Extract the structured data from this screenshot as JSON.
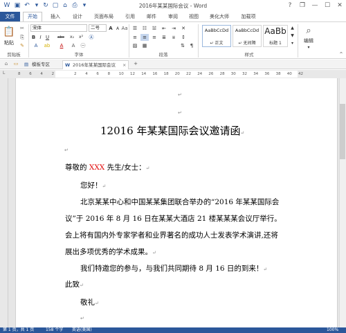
{
  "title_bar": {
    "document_title": "2016年某某国际会议 - Word",
    "help": "?",
    "restore": "❐",
    "minimize": "—",
    "maximize": "☐",
    "close": "✕"
  },
  "menu": {
    "file": "文件",
    "home": "开始",
    "insert": "插入",
    "design": "设计",
    "layout": "页面布局",
    "references": "引用",
    "mailings": "邮件",
    "review": "审阅",
    "view": "视图",
    "beautify": "美化大师",
    "addins": "加载项"
  },
  "ribbon": {
    "clipboard": {
      "paste": "粘贴",
      "label": "剪贴板"
    },
    "font": {
      "name": "宋体",
      "size": "二号",
      "grow": "A",
      "shrink": "A",
      "bold": "B",
      "italic": "I",
      "underline": "U",
      "strike": "abc",
      "sub": "x₂",
      "sup": "x²",
      "color_a": "A",
      "label": "字体"
    },
    "paragraph": {
      "label": "段落"
    },
    "styles": {
      "label": "样式",
      "items": [
        {
          "sample": "AaBbCcDd",
          "name": "↵ 正文"
        },
        {
          "sample": "AaBbCcDd",
          "name": "↵ 无间隔"
        },
        {
          "sample": "AaBb",
          "name": "标题 1"
        }
      ]
    },
    "editing": {
      "label": "编辑"
    }
  },
  "tabs": [
    {
      "label": "模板专区"
    },
    {
      "label": "2016年某某国际会议"
    }
  ],
  "ruler": {
    "ticks": [
      "8",
      "6",
      "4",
      "2",
      "",
      "2",
      "4",
      "6",
      "8",
      "10",
      "12",
      "14",
      "16",
      "18",
      "20",
      "22",
      "24",
      "26",
      "28",
      "30",
      "32",
      "34",
      "36",
      "38",
      "40",
      "42"
    ]
  },
  "document": {
    "title_prefix": "1",
    "title": "2016 年某某国际会议邀请函",
    "salutation_pre": "尊敬的",
    "salutation_name": "XXX",
    "salutation_post": "先生/女士：",
    "greeting": "您好！",
    "para1_line1": "北京某某中心和中国某某集团联合举办的“2016 年某某国际会",
    "para1_line2": "议”于 2016 年 8 月 16 日在某某大酒店 21 楼某某某会议厅举行。",
    "para1_line3": "会上将有国内外专家学者和业界著名的成功人士发表学术演讲,还将",
    "para1_line4": "展出多项优秀的学术成果。",
    "para2": "我们特邀您的参与，与我们共同期待 8 月 16 日的到来！",
    "closing1": "此致",
    "closing2": "敬礼",
    "para_mark": "↵"
  },
  "status": {
    "page": "第 1 页，共 1 页",
    "words": "158 个字",
    "lang": "英语(美国)",
    "zoom": "100%"
  },
  "colors": {
    "accent": "#2b579a",
    "red_text": "#e00000"
  }
}
